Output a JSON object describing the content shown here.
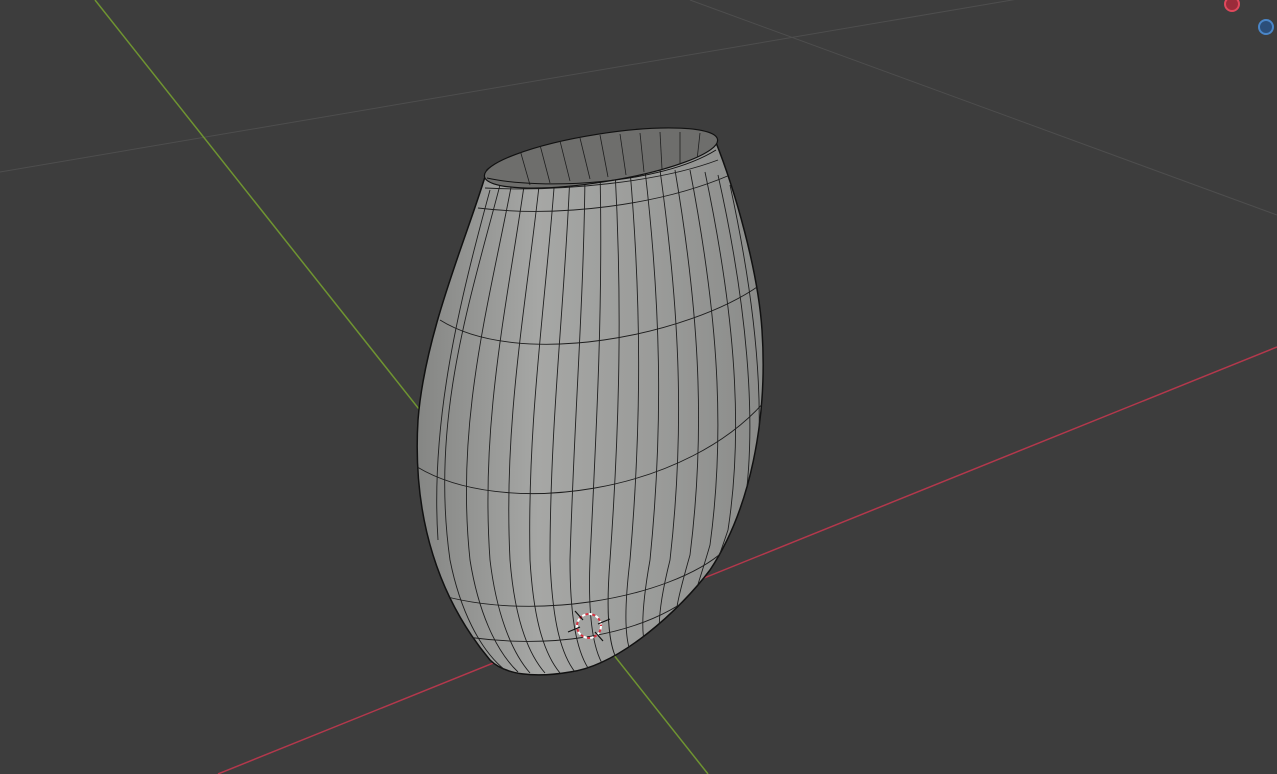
{
  "viewport": {
    "background": "#3d3d3d",
    "grid_color": "#4d4d4d",
    "x_axis_color": "#b3384c",
    "y_axis_color": "#6f9431",
    "object": {
      "shape": "vase",
      "surface_color": "#9a9b99",
      "wire_color": "#1a1a1a"
    },
    "cursor": "3d-cursor-icon",
    "gizmo": {
      "x_color": "#e0485c",
      "z_color": "#4a86c8"
    }
  }
}
